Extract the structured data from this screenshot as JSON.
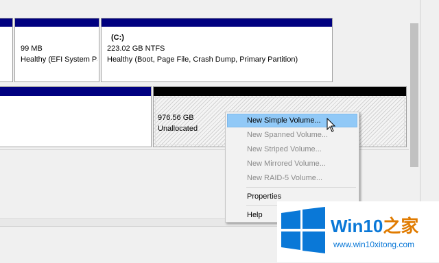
{
  "disk0": {
    "partition1": {
      "size": "99 MB",
      "status": "Healthy (EFI System Pa"
    },
    "partition2": {
      "label": "(C:)",
      "size": "223.02 GB NTFS",
      "status": "Healthy (Boot, Page File, Crash Dump, Primary Partition)"
    }
  },
  "disk1": {
    "unallocated": {
      "size": "976.56 GB",
      "status": "Unallocated"
    }
  },
  "context_menu": {
    "items": [
      {
        "label": "New Simple Volume...",
        "enabled": true
      },
      {
        "label": "New Spanned Volume...",
        "enabled": false
      },
      {
        "label": "New Striped Volume...",
        "enabled": false
      },
      {
        "label": "New Mirrored Volume...",
        "enabled": false
      },
      {
        "label": "New RAID-5 Volume...",
        "enabled": false
      },
      {
        "label": "Properties",
        "enabled": true
      },
      {
        "label": "Help",
        "enabled": true
      }
    ]
  },
  "watermark": {
    "brand": "Win10",
    "brand_suffix": "之家",
    "url": "www.win10xitong.com"
  },
  "colors": {
    "partition_bar": "#000080",
    "unallocated_bar": "#000000",
    "menu_highlight": "#91c9f7",
    "logo_blue": "#0a78d7"
  }
}
